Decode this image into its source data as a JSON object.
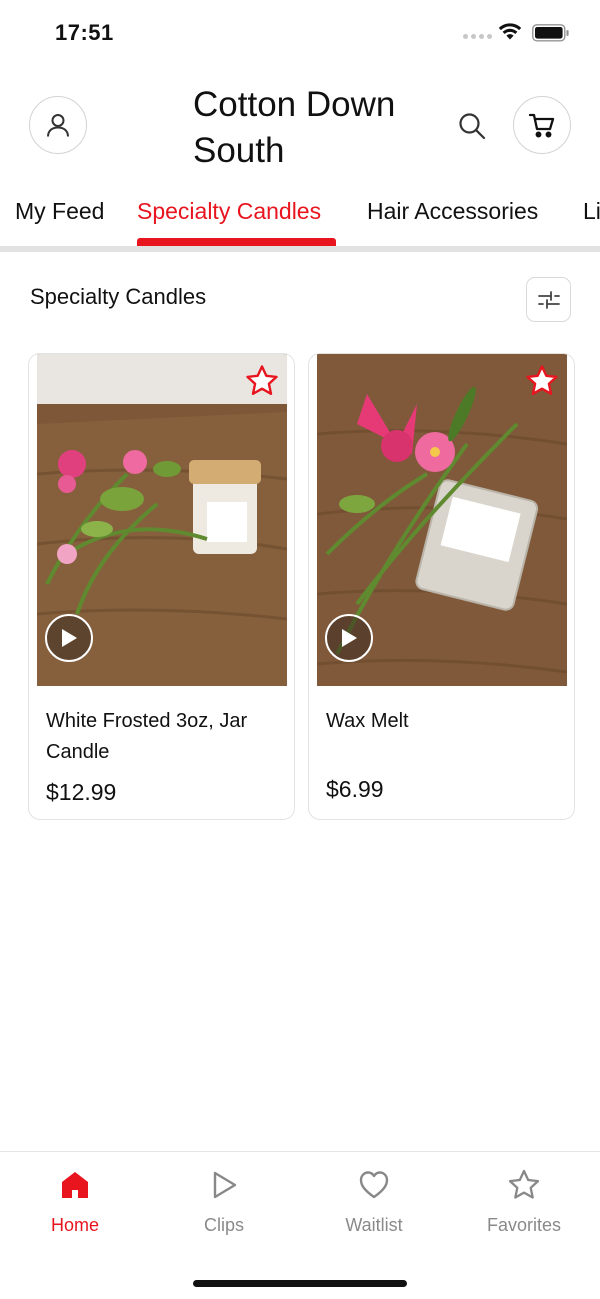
{
  "status_bar": {
    "time": "17:51"
  },
  "header": {
    "title": "Cotton Down South",
    "profile_icon": "profile-icon",
    "search_icon": "search-icon",
    "cart_icon": "cart-icon"
  },
  "tabs": [
    {
      "label": "My Feed",
      "active": false
    },
    {
      "label": "Specialty Candles",
      "active": true
    },
    {
      "label": "Hair Accessories",
      "active": false
    },
    {
      "label": "Li",
      "active": false
    }
  ],
  "section": {
    "title": "Specialty Candles",
    "filter_icon": "sliders-icon"
  },
  "products": [
    {
      "name": "White Frosted 3oz, Jar Candle",
      "price": "$12.99",
      "favorite_icon": "star-icon",
      "video_icon": "play-icon"
    },
    {
      "name": "Wax Melt",
      "price": "$6.99",
      "favorite_icon": "star-icon",
      "video_icon": "play-icon"
    }
  ],
  "bottom_nav": [
    {
      "label": "Home",
      "icon": "home-icon",
      "active": true
    },
    {
      "label": "Clips",
      "icon": "play-icon",
      "active": false
    },
    {
      "label": "Waitlist",
      "icon": "heart-icon",
      "active": false
    },
    {
      "label": "Favorites",
      "icon": "star-icon",
      "active": false
    }
  ],
  "colors": {
    "accent": "#e8151f",
    "inactive": "#8a8a8a",
    "border": "#e3e3e3"
  }
}
